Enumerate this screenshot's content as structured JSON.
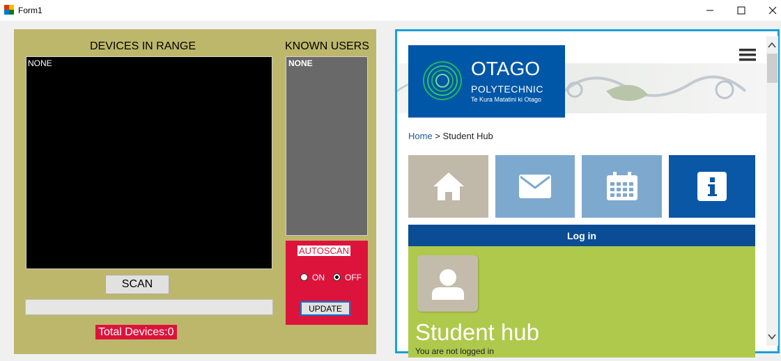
{
  "window": {
    "title": "Form1"
  },
  "left": {
    "devices_header": "DEVICES IN RANGE",
    "devices_list": [
      "NONE"
    ],
    "known_header": "KNOWN USERS",
    "known_list": [
      "NONE"
    ],
    "scan_label": "SCAN",
    "progress_value": 0,
    "total_devices": "Total Devices:0",
    "autoscan_label": "AUTOSCAN",
    "on_label": "ON",
    "off_label": "OFF",
    "autoscan_selected": "OFF",
    "update_label": "UPDATE"
  },
  "browser": {
    "logo": {
      "name": "OTAGO",
      "sub": "POLYTECHNIC",
      "tagline": "Te Kura Matatini ki Otago"
    },
    "breadcrumb": {
      "home": "Home",
      "sep": " > ",
      "current": "Student Hub"
    },
    "tiles": [
      {
        "icon": "home-icon",
        "color": "#c0b9a9"
      },
      {
        "icon": "mail-icon",
        "color": "#7ea9cf"
      },
      {
        "icon": "calendar-icon",
        "color": "#7ea9cf"
      },
      {
        "icon": "info-icon",
        "color": "#0a57a6"
      }
    ],
    "login_label": "Log in",
    "hub_title": "Student hub",
    "hub_subtitle": "You are not logged in"
  },
  "colors": {
    "panel": "#bdb76b",
    "accent_red": "#dc143c",
    "browser_border": "#1aa0d8",
    "brand_blue": "#0057a8",
    "hub_green": "#aec94b"
  }
}
